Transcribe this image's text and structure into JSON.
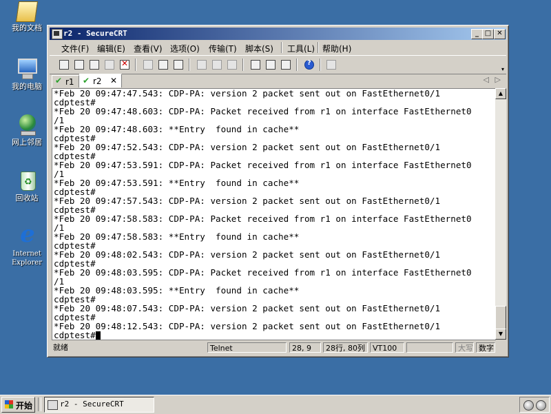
{
  "desktop": {
    "icons": [
      {
        "label": "我的文档",
        "icon": "my-documents-icon"
      },
      {
        "label": "我的电脑",
        "icon": "my-computer-icon"
      },
      {
        "label": "网上邻居",
        "icon": "network-places-icon"
      },
      {
        "label": "回收站",
        "icon": "recycle-bin-icon"
      },
      {
        "label": "Internet Explorer",
        "icon": "internet-explorer-icon"
      }
    ]
  },
  "window": {
    "title": "r2 - SecureCRT",
    "menu": [
      "文件(F)",
      "编辑(E)",
      "查看(V)",
      "选项(O)",
      "传输(T)",
      "脚本(S)",
      "工具(L)",
      "帮助(H)"
    ],
    "tabs": [
      {
        "label": "r1",
        "active": false
      },
      {
        "label": "r2",
        "active": true
      }
    ],
    "terminal_lines": [
      "*Feb 20 09:47:47.543: CDP-PA: version 2 packet sent out on FastEthernet0/1",
      "cdptest#",
      "*Feb 20 09:47:48.603: CDP-PA: Packet received from r1 on interface FastEthernet0",
      "/1",
      "*Feb 20 09:47:48.603: **Entry  found in cache**",
      "cdptest#",
      "*Feb 20 09:47:52.543: CDP-PA: version 2 packet sent out on FastEthernet0/1",
      "cdptest#",
      "*Feb 20 09:47:53.591: CDP-PA: Packet received from r1 on interface FastEthernet0",
      "/1",
      "*Feb 20 09:47:53.591: **Entry  found in cache**",
      "cdptest#",
      "*Feb 20 09:47:57.543: CDP-PA: version 2 packet sent out on FastEthernet0/1",
      "cdptest#",
      "*Feb 20 09:47:58.583: CDP-PA: Packet received from r1 on interface FastEthernet0",
      "/1",
      "*Feb 20 09:47:58.583: **Entry  found in cache**",
      "cdptest#",
      "*Feb 20 09:48:02.543: CDP-PA: version 2 packet sent out on FastEthernet0/1",
      "cdptest#",
      "*Feb 20 09:48:03.595: CDP-PA: Packet received from r1 on interface FastEthernet0",
      "/1",
      "*Feb 20 09:48:03.595: **Entry  found in cache**",
      "cdptest#",
      "*Feb 20 09:48:07.543: CDP-PA: version 2 packet sent out on FastEthernet0/1",
      "cdptest#",
      "*Feb 20 09:48:12.543: CDP-PA: version 2 packet sent out on FastEthernet0/1"
    ],
    "prompt": "cdptest#",
    "status": {
      "ready": "就绪",
      "protocol": "Telnet",
      "cursor_pos": "28,  9",
      "rows_cols": "28行, 80列",
      "emulation": "VT100",
      "caps": "大写",
      "num": "数字"
    }
  },
  "taskbar": {
    "start_label": "开始",
    "task_label": "r2 - SecureCRT"
  }
}
